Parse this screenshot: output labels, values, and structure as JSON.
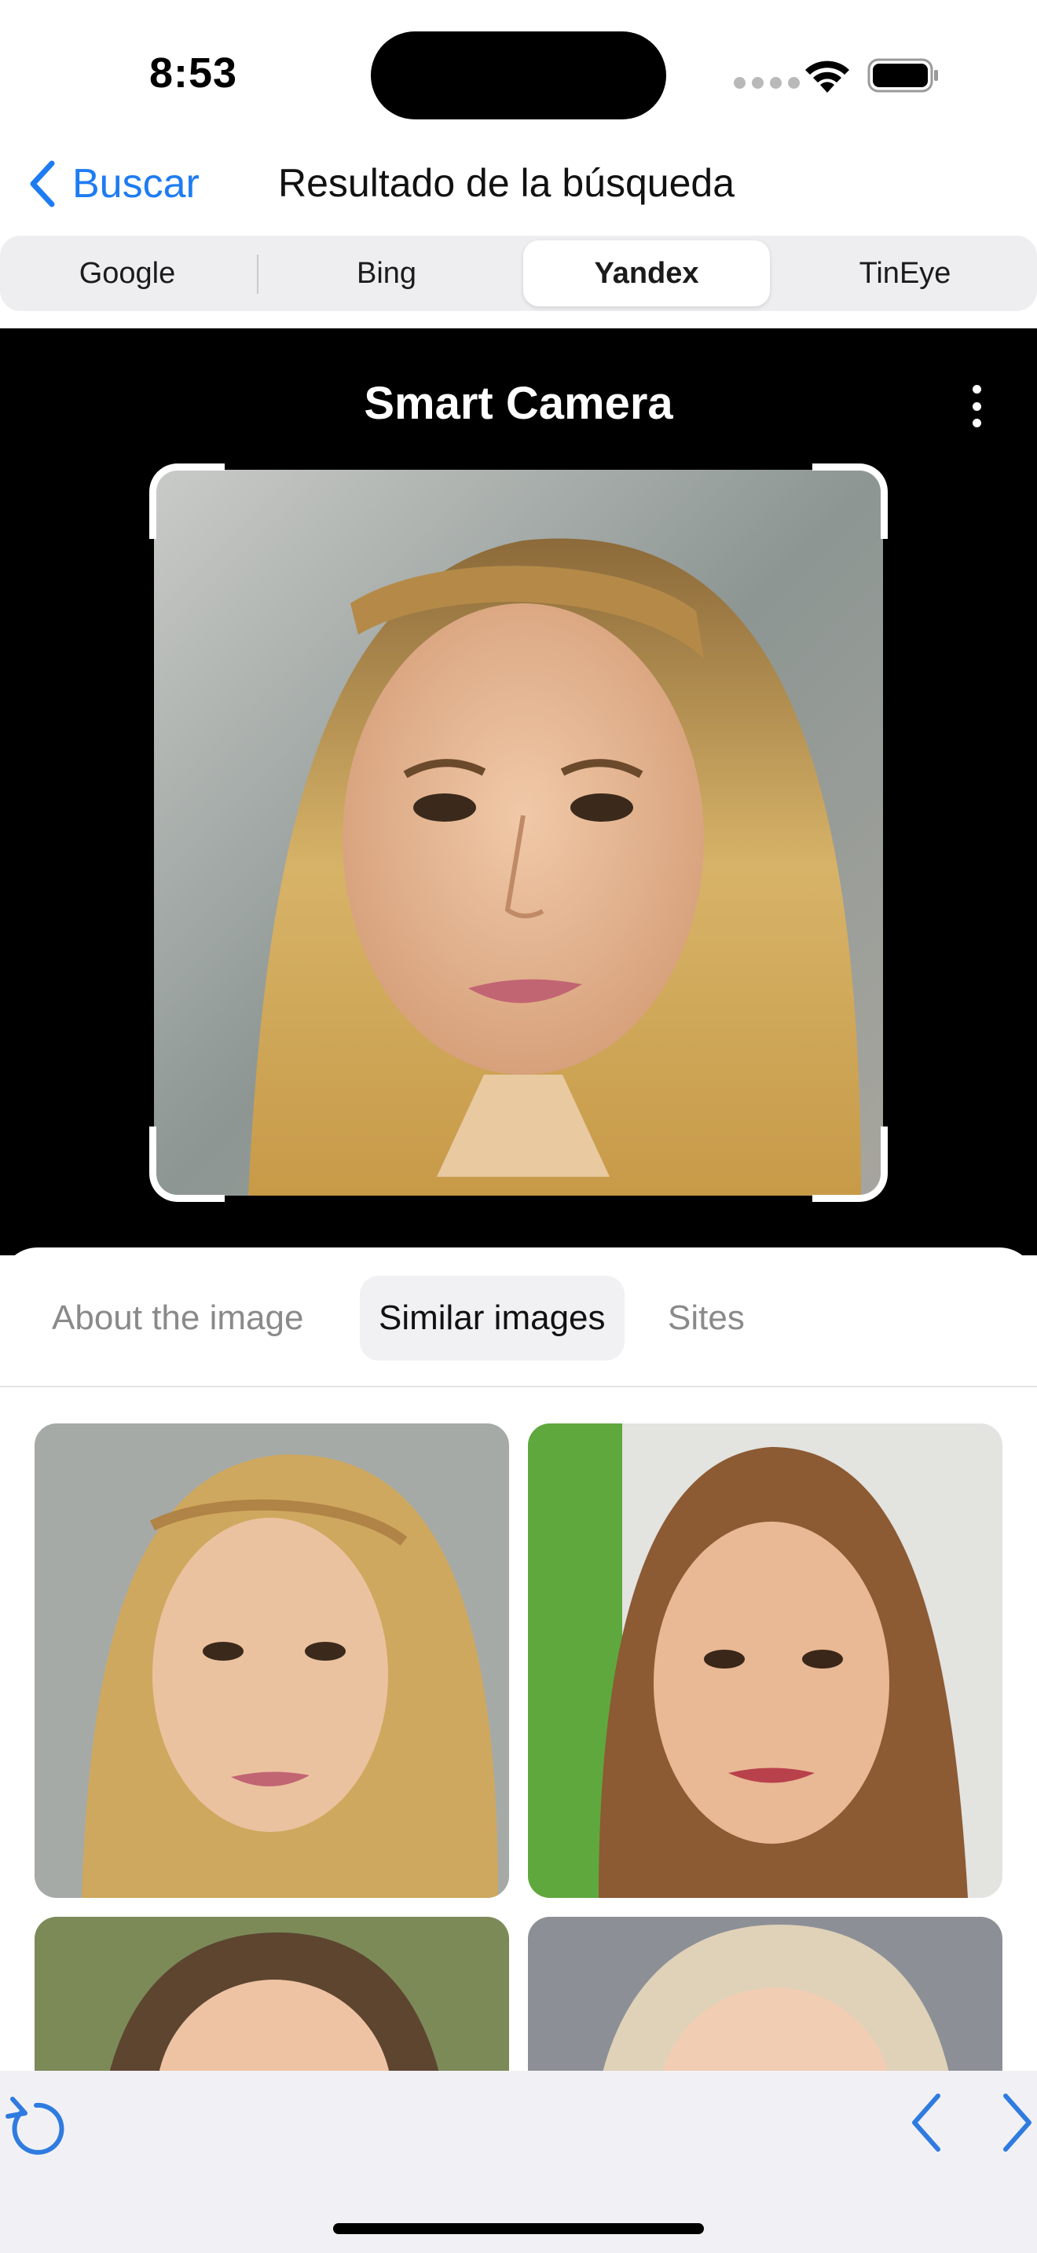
{
  "status_bar": {
    "time": "8:53"
  },
  "nav": {
    "back_label": "Buscar",
    "title": "Resultado de la búsqueda"
  },
  "engines": {
    "tabs": [
      "Google",
      "Bing",
      "Yandex",
      "TinEye"
    ],
    "selected": "Yandex"
  },
  "camera": {
    "title": "Smart Camera"
  },
  "result_tabs": {
    "items": [
      "About the image",
      "Similar images",
      "Sites"
    ],
    "selected": "Similar images"
  },
  "colors": {
    "accent": "#1e7cf2",
    "camera_bg": "#000000",
    "toolbar_bg": "#f1f1f5"
  },
  "icons": {
    "back": "chevron-left-icon",
    "wifi": "wifi-icon",
    "battery": "battery-icon",
    "menu": "more-vertical-icon",
    "reload": "reload-icon",
    "prev": "chevron-left-icon",
    "next": "chevron-right-icon"
  }
}
